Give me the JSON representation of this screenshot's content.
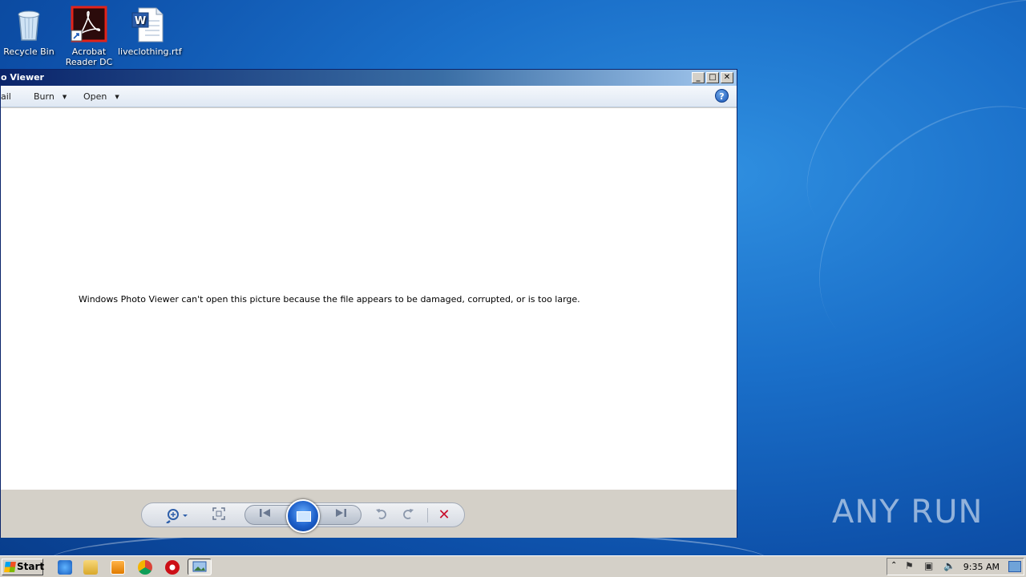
{
  "desktop": {
    "icons": [
      {
        "label": "Recycle Bin",
        "icon": "recycle-bin-icon"
      },
      {
        "label": "Acrobat Reader DC",
        "icon": "acrobat-icon"
      },
      {
        "label": "liveclothing.rtf",
        "icon": "word-document-icon"
      }
    ],
    "watermark": "ANY RUN"
  },
  "window": {
    "title": "o Viewer",
    "toolbar": {
      "item_partial": "ail",
      "burn": "Burn",
      "open": "Open"
    },
    "message": "Windows Photo Viewer can't open this picture because the file appears to be damaged, corrupted, or is too large."
  },
  "taskbar": {
    "start": "Start",
    "clock": "9:35 AM"
  },
  "colors": {
    "title_active": "#0a246a",
    "delete": "#c8102e"
  }
}
